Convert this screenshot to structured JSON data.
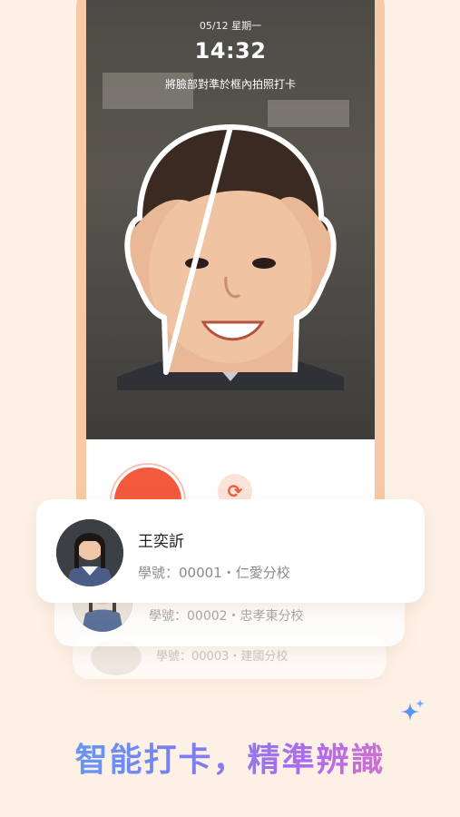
{
  "camera": {
    "date": "05/12  星期一",
    "time": "14:32",
    "hint": "將臉部對準於框內拍照打卡"
  },
  "icons": {
    "shutter": "shutter-button",
    "switch_camera": "refresh-icon",
    "sparkle": "sparkle-icon"
  },
  "students": [
    {
      "name": "王奕訢",
      "info": "學號：00001・仁愛分校"
    },
    {
      "info": "學號：00002・忠孝東分校"
    },
    {
      "info": "學號：00003・建國分校"
    }
  ],
  "slogan": "智能打卡，精準辨識",
  "colors": {
    "accent": "#f3593b",
    "frame": "#f7c9a6",
    "background": "#fdf1e6"
  }
}
